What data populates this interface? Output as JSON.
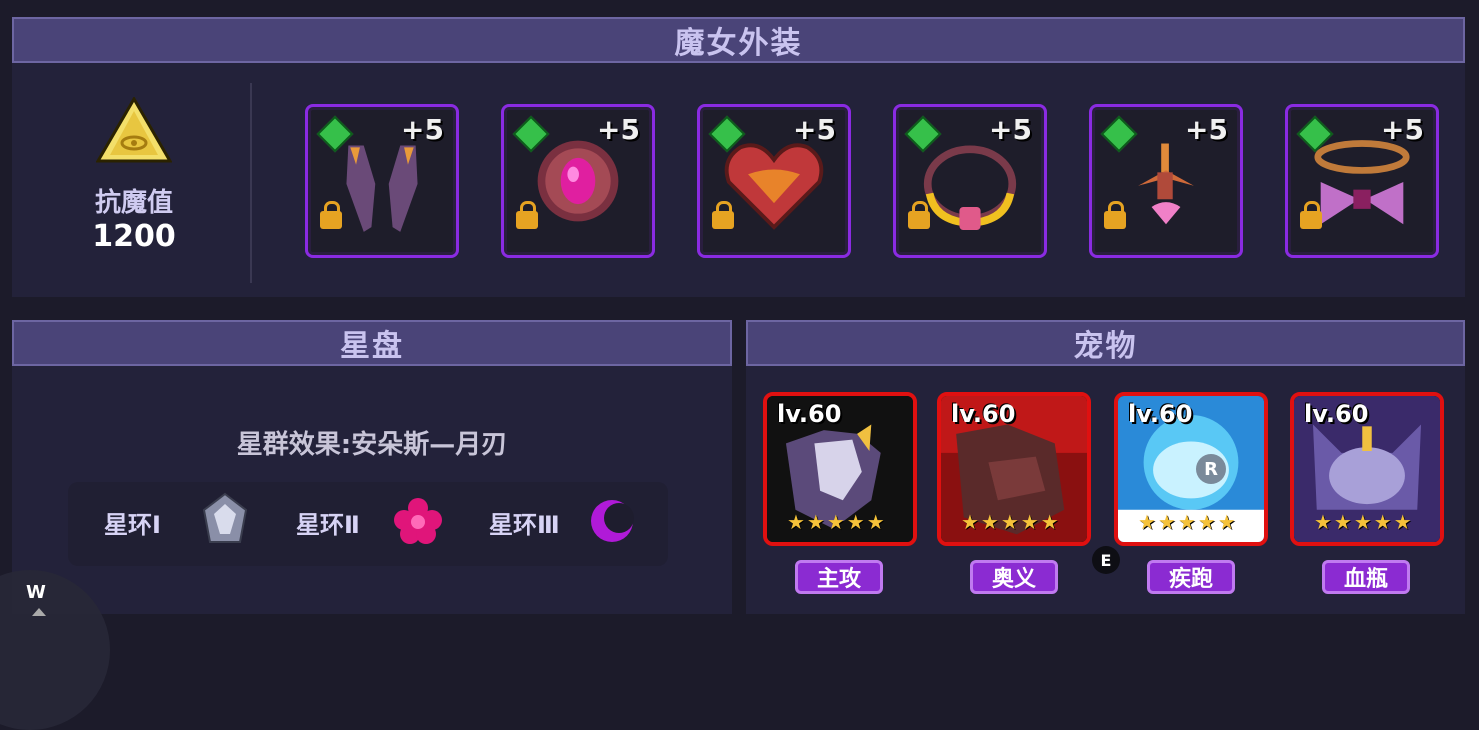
{
  "witch_outfit": {
    "title": "魔女外装",
    "resist_label": "抗魔值",
    "resist_value": "1200",
    "slots": [
      {
        "item": "horns",
        "bonus": "+5"
      },
      {
        "item": "core-gem",
        "bonus": "+5"
      },
      {
        "item": "heart",
        "bonus": "+5"
      },
      {
        "item": "ring-necklace",
        "bonus": "+5"
      },
      {
        "item": "pendant",
        "bonus": "+5"
      },
      {
        "item": "bow-headband",
        "bonus": "+5"
      }
    ]
  },
  "star_disk": {
    "title": "星盘",
    "effect": "星群效果:安朵斯—月刃",
    "rings": [
      {
        "label": "星环Ⅰ",
        "icon": "silver-crystal-icon"
      },
      {
        "label": "星环Ⅱ",
        "icon": "pink-flower-icon"
      },
      {
        "label": "星环Ⅲ",
        "icon": "purple-moon-icon"
      }
    ]
  },
  "pets": {
    "title": "宠物",
    "list": [
      {
        "level": "lv.60",
        "role": "主攻",
        "stars": 5
      },
      {
        "level": "lv.60",
        "role": "奥义",
        "stars": 5
      },
      {
        "level": "lv.60",
        "role": "疾跑",
        "stars": 5
      },
      {
        "level": "lv.60",
        "role": "血瓶",
        "stars": 5
      }
    ],
    "badge_r": "R"
  },
  "overlay": {
    "key_w": "W",
    "key_e": "E"
  },
  "colors": {
    "header_bg": "#4a4478",
    "slot_border": "#8a2be2",
    "pet_border": "#e01010",
    "tag_bg": "#8b2bd2"
  }
}
